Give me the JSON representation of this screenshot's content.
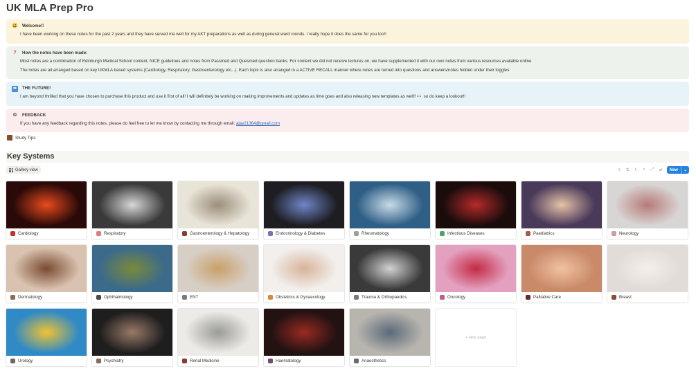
{
  "page": {
    "title": "UK MLA Prep Pro"
  },
  "callouts": {
    "welcome": {
      "icon": "grinning-face-icon",
      "title": "Welcome!!",
      "body": "I have been working on these notes for the past 2 years and they have served me well for my AKT preparations as well as during general ward rounds. I really hope it does the same for you too!!"
    },
    "how": {
      "icon": "question-mark-icon",
      "title": "How the notes have been made:",
      "body1": "Most notes are a combination of Edinburgh Medical School content, NICE guidelines and notes from Passmed and Quesmed question banks. For content we did not receive lectures on, we have supplemented it with our own notes from various resources available online",
      "body2": "The notes are all arranged based on key UKMLA based systems (Cardiology, Respiratory, Gastroenterology etc...). Each topic is also arranged in a ACTIVE RECALL manner where notes are turned into questions and answers/notes hidden under their toggles"
    },
    "future": {
      "icon": "right-arrow-icon",
      "title": "THE FUTURE!",
      "body": "I am beyond thrilled that you have chosen to purchase this product and use it first of all! I will definitely be working on making improvements and updates as time goes and also releasing new templates as well!! 👀 so do keep a lookout!!"
    },
    "feedback": {
      "icon": "gear-icon",
      "title": "FEEDBACK",
      "body": "If you have any feedback regarding this notes, please do feel free to let me know by contacting me through email: ",
      "email": "ajay21364@gmail.com"
    }
  },
  "study_tips": {
    "label": "Study Tips"
  },
  "key_systems": {
    "title": "Key Systems",
    "view_label": "Gallery view",
    "new_label": "New",
    "new_page_label": "+ New page",
    "cards": [
      {
        "label": "Cardiology",
        "color": "#2a0a08",
        "accent": "#e84b1e",
        "icon_color": "#c9302c"
      },
      {
        "label": "Respiratory",
        "color": "#3a3a3a",
        "accent": "#d8d8d8",
        "icon_color": "#e07b7b"
      },
      {
        "label": "Gastroenterology & Hepatology",
        "color": "#e9e4d8",
        "accent": "#9a8f7a",
        "icon_color": "#8b3a2f"
      },
      {
        "label": "Endocrinology & Diabetes",
        "color": "#1d1d22",
        "accent": "#6f86c9",
        "icon_color": "#7d6fb3"
      },
      {
        "label": "Rheumatology",
        "color": "#2f5f86",
        "accent": "#c9dbe8",
        "icon_color": "#9e9e9e"
      },
      {
        "label": "Infectious Diseases",
        "color": "#1b0c0c",
        "accent": "#b52a2a",
        "icon_color": "#4aa36b"
      },
      {
        "label": "Paediatrics",
        "color": "#4a3a5a",
        "accent": "#e7c2a7",
        "icon_color": "#a85a4a"
      },
      {
        "label": "Neurology",
        "color": "#d8d6d4",
        "accent": "#b77a78",
        "icon_color": "#d49a9a"
      },
      {
        "label": "Dermatology",
        "color": "#d9c2b0",
        "accent": "#7a4a30",
        "icon_color": "#8a6a5a"
      },
      {
        "label": "Ophthalmology",
        "color": "#3c6a8a",
        "accent": "#7a8a3a",
        "icon_color": "#4a4a4a"
      },
      {
        "label": "ENT",
        "color": "#d7cfc5",
        "accent": "#c9a06a",
        "icon_color": "#7a7a7a"
      },
      {
        "label": "Obstetrics & Gynaecology",
        "color": "#f2efec",
        "accent": "#d8b49a",
        "icon_color": "#d9893a"
      },
      {
        "label": "Trauma & Orthopaedics",
        "color": "#3a3a3a",
        "accent": "#d2d2d2",
        "icon_color": "#7a7a7a"
      },
      {
        "label": "Oncology",
        "color": "#e3a0bf",
        "accent": "#c42a44",
        "icon_color": "#c25a8a"
      },
      {
        "label": "Palliative Care",
        "color": "#c98a6a",
        "accent": "#f0c2a2",
        "icon_color": "#6a2a2a"
      },
      {
        "label": "Breast",
        "color": "#e2dcd8",
        "accent": "#f5efec",
        "icon_color": "#8a4a3a"
      },
      {
        "label": "Urology",
        "color": "#2f8ac6",
        "accent": "#f2c230",
        "icon_color": "#6a6a6a"
      },
      {
        "label": "Psychiatry",
        "color": "#1e1e1e",
        "accent": "#9a7a68",
        "icon_color": "#8a6a5a"
      },
      {
        "label": "Renal Medicine",
        "color": "#ecebe8",
        "accent": "#9a9a96",
        "icon_color": "#8a3a2a"
      },
      {
        "label": "Haematology",
        "color": "#221212",
        "accent": "#9a2a22",
        "icon_color": "#7a4a6a"
      },
      {
        "label": "Anaesthetics",
        "color": "#b8b4ae",
        "accent": "#5a6a7a",
        "icon_color": "#6a6a6a"
      }
    ]
  },
  "toolbar_icons": [
    "filter-icon",
    "sort-icon",
    "lightning-icon",
    "search-icon",
    "expand-icon",
    "settings-icon"
  ]
}
